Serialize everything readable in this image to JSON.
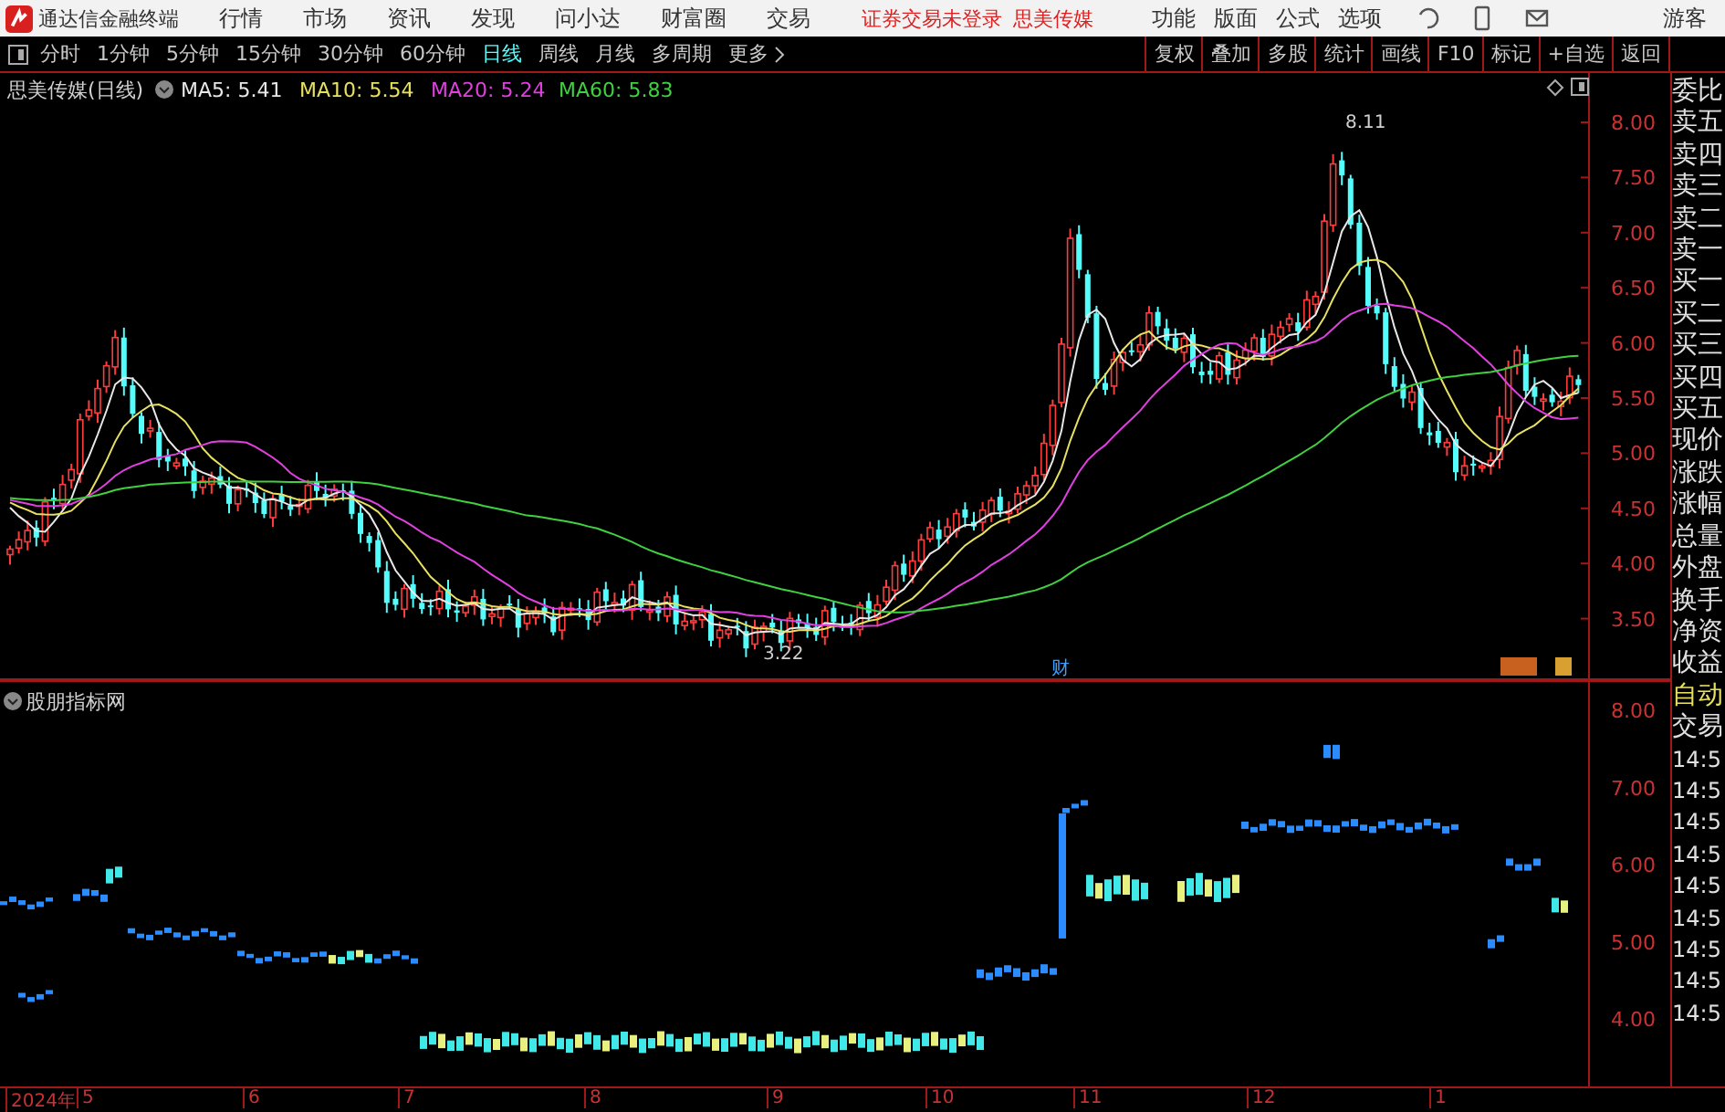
{
  "menu_bar": {
    "app_title": "通达信金融终端",
    "items": [
      "行情",
      "市场",
      "资讯",
      "发现",
      "问小达",
      "财富圈",
      "交易"
    ],
    "status_text": "证券交易未登录",
    "stock_name": "思美传媒",
    "right_items": [
      "功能",
      "版面",
      "公式",
      "选项"
    ],
    "user": "游客"
  },
  "period_tabs": [
    {
      "label": "分时",
      "selected": false
    },
    {
      "label": "1分钟",
      "selected": false
    },
    {
      "label": "5分钟",
      "selected": false
    },
    {
      "label": "15分钟",
      "selected": false
    },
    {
      "label": "30分钟",
      "selected": false
    },
    {
      "label": "60分钟",
      "selected": false
    },
    {
      "label": "日线",
      "selected": true
    },
    {
      "label": "周线",
      "selected": false
    },
    {
      "label": "月线",
      "selected": false
    },
    {
      "label": "多周期",
      "selected": false
    },
    {
      "label": "更多",
      "selected": false
    }
  ],
  "tool_buttons": [
    "复权",
    "叠加",
    "多股",
    "统计",
    "画线",
    "F10",
    "标记",
    "+自选",
    "返回"
  ],
  "main_chart": {
    "title": "思美传媒(日线)",
    "ma": [
      {
        "label": "MA5: 5.41",
        "color": "#e8e8e8"
      },
      {
        "label": "MA10: 5.54",
        "color": "#e8e060"
      },
      {
        "label": "MA20: 5.24",
        "color": "#e040e0"
      },
      {
        "label": "MA60: 5.83",
        "color": "#40d040"
      }
    ],
    "yticks": [
      "8.00",
      "7.50",
      "7.00",
      "6.50",
      "6.00",
      "5.50",
      "5.00",
      "4.50",
      "4.00",
      "3.50"
    ],
    "high_label": "8.11",
    "low_label": "3.22",
    "marker": "财"
  },
  "indicator_chart": {
    "title": "股朋指标网",
    "yticks": [
      "8.00",
      "7.00",
      "6.00",
      "5.00",
      "4.00"
    ]
  },
  "x_axis": [
    "2024年",
    "5",
    "6",
    "7",
    "8",
    "9",
    "10",
    "11",
    "12",
    "1"
  ],
  "side_panel": {
    "labels": [
      "委比",
      "卖五",
      "卖四",
      "卖三",
      "卖二",
      "卖一",
      "买一",
      "买二",
      "买三",
      "买四",
      "买五",
      "现价",
      "涨跌",
      "涨幅",
      "总量",
      "外盘",
      "换手",
      "净资",
      "收益"
    ],
    "mode": "自动",
    "trade_label": "交易",
    "times": [
      "14:5",
      "14:5",
      "14:5",
      "14:5",
      "14:5",
      "14:5",
      "14:5",
      "14:5",
      "14:5"
    ]
  }
}
